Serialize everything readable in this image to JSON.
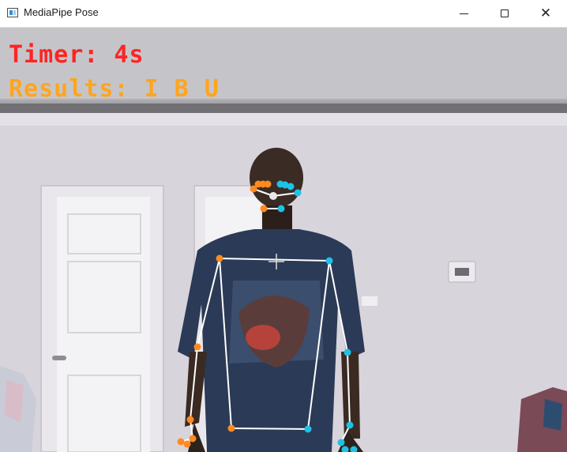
{
  "window": {
    "title": "MediaPipe Pose",
    "controls": {
      "minimize": "minimize-icon",
      "maximize": "maximize-icon",
      "close": "close-icon"
    }
  },
  "overlay": {
    "timer_text": "Timer: 4s",
    "results_text": "Results: I B U",
    "timer_color": "#ff2424",
    "results_color": "#ffa51e"
  },
  "pose": {
    "left_point_color": "#ff8a1f",
    "right_point_color": "#1ec2e6",
    "center_point_color": "#e8e8e8",
    "line_color": "#ffffff"
  }
}
